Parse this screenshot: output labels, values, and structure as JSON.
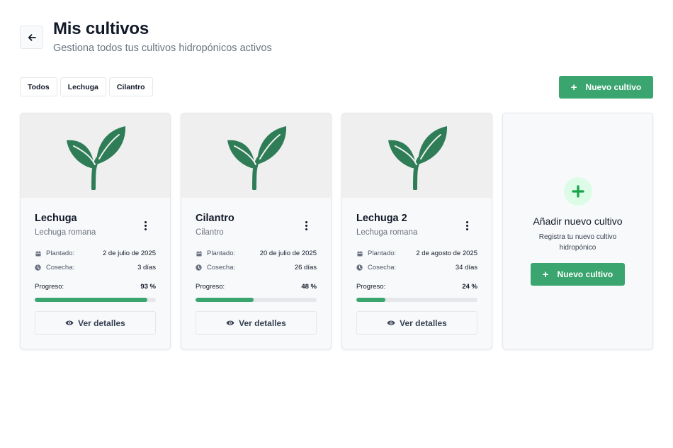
{
  "header": {
    "title": "Mis cultivos",
    "subtitle": "Gestiona todos tus cultivos hidropónicos activos"
  },
  "filters": [
    "Todos",
    "Lechuga",
    "Cilantro"
  ],
  "new_crop_label": "Nuevo cultivo",
  "accent_color": "#3aa56f",
  "crops": [
    {
      "name": "Lechuga",
      "variety": "Lechuga romana",
      "planted_label": "Plantado:",
      "planted_value": "2 de julio de 2025",
      "harvest_label": "Cosecha:",
      "harvest_value": "3 días",
      "progress_label": "Progreso:",
      "progress_text": "93 %",
      "progress": 93,
      "details_label": "Ver detalles"
    },
    {
      "name": "Cilantro",
      "variety": "Cilantro",
      "planted_label": "Plantado:",
      "planted_value": "20 de julio de 2025",
      "harvest_label": "Cosecha:",
      "harvest_value": "26 días",
      "progress_label": "Progreso:",
      "progress_text": "48 %",
      "progress": 48,
      "details_label": "Ver detalles"
    },
    {
      "name": "Lechuga 2",
      "variety": "Lechuga romana",
      "planted_label": "Plantado:",
      "planted_value": "2 de agosto de 2025",
      "harvest_label": "Cosecha:",
      "harvest_value": "34 días",
      "progress_label": "Progreso:",
      "progress_text": "24 %",
      "progress": 24,
      "details_label": "Ver detalles"
    }
  ],
  "add_card": {
    "title": "Añadir nuevo cultivo",
    "description": "Registra tu nuevo cultivo hidropónico",
    "button_label": "Nuevo cultivo"
  },
  "icons": {
    "back": "arrow-left-icon",
    "plant": "sprout-icon",
    "menu": "kebab-menu-icon",
    "planted": "calendar-icon",
    "harvest": "clock-icon",
    "details": "eye-icon",
    "add": "plus-icon"
  }
}
